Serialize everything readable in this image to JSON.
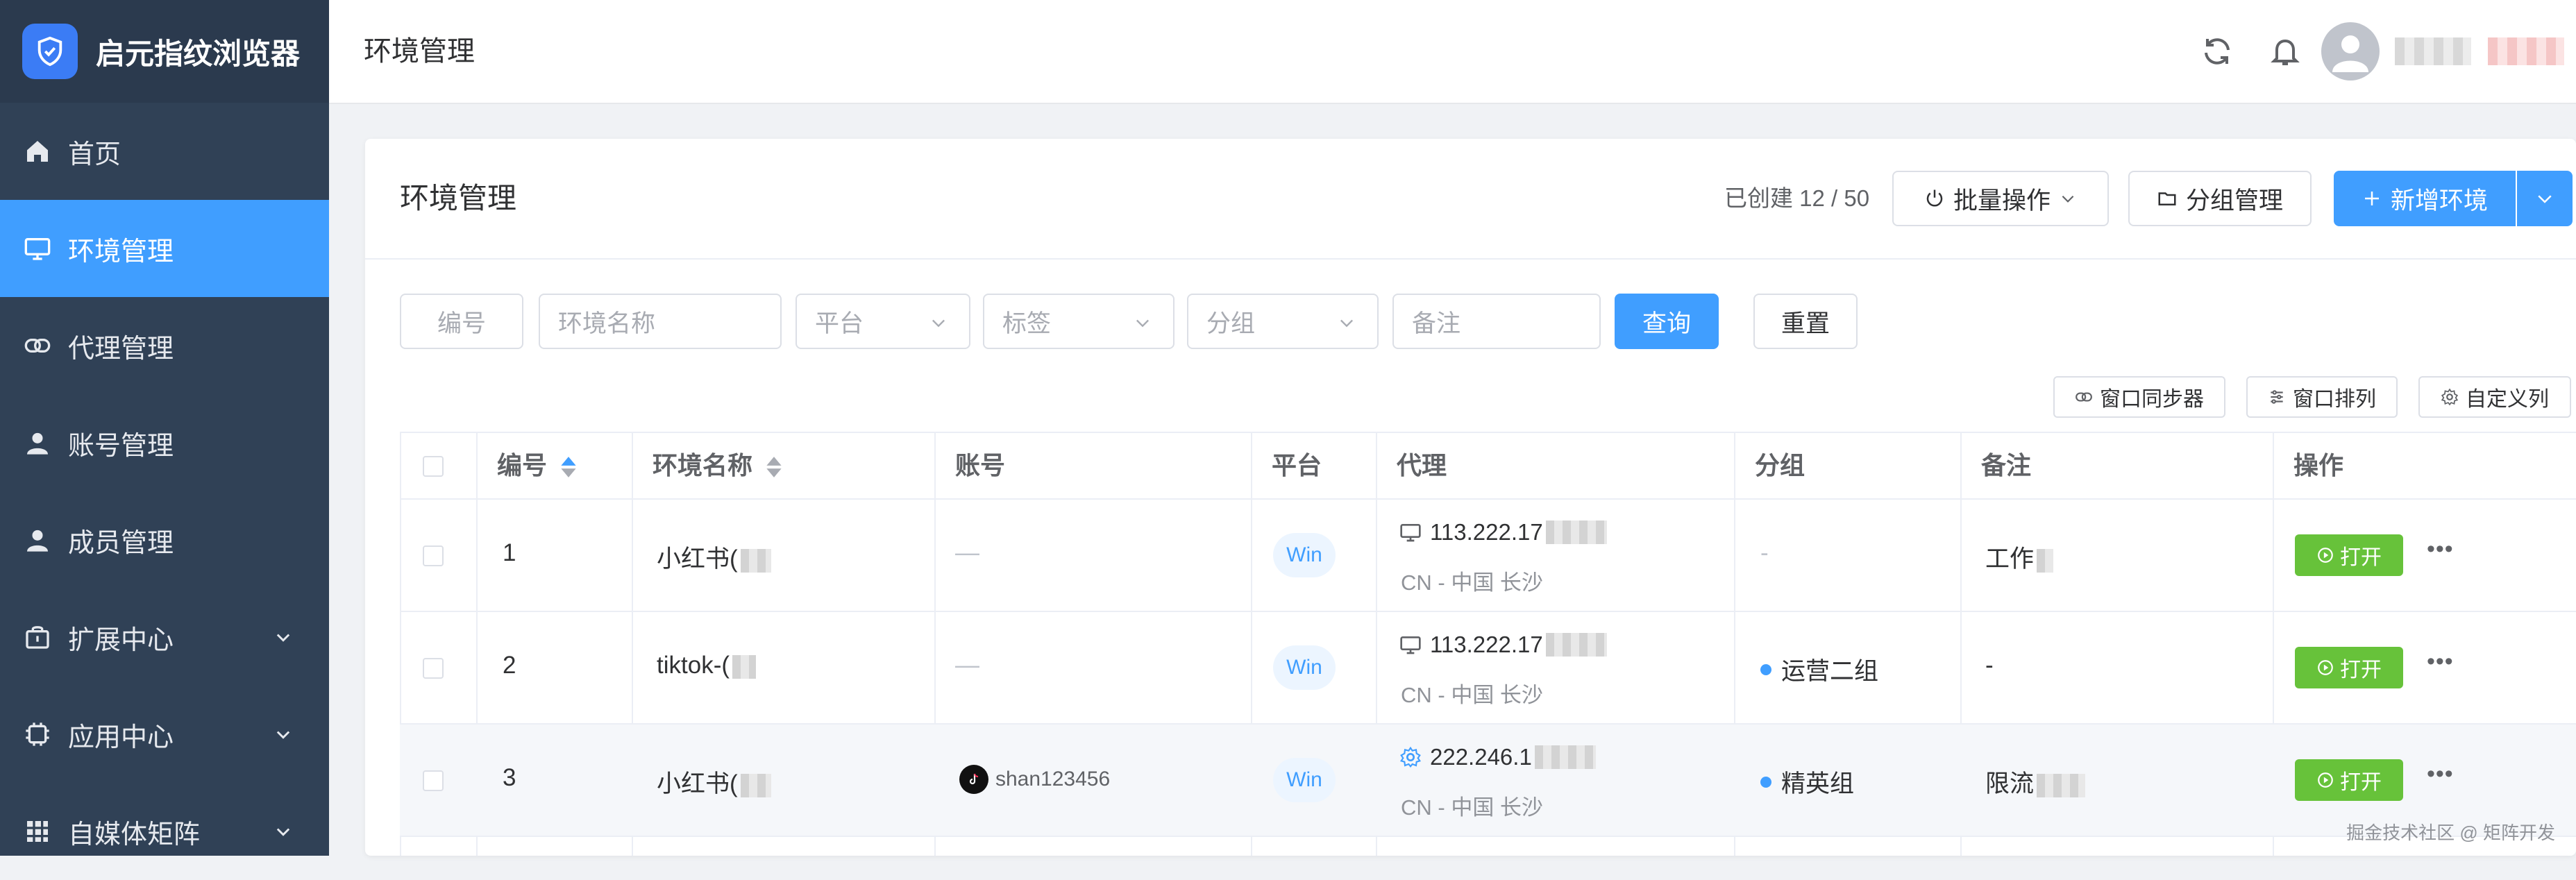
{
  "app": {
    "name": "启元指纹浏览器"
  },
  "sidebar": {
    "items": [
      {
        "label": "首页",
        "icon": "home-icon",
        "active": false
      },
      {
        "label": "环境管理",
        "icon": "monitor-icon",
        "active": true
      },
      {
        "label": "代理管理",
        "icon": "link-icon",
        "active": false
      },
      {
        "label": "账号管理",
        "icon": "user-icon",
        "active": false
      },
      {
        "label": "成员管理",
        "icon": "user-icon",
        "active": false
      },
      {
        "label": "扩展中心",
        "icon": "shop-icon",
        "active": false,
        "expandable": true
      },
      {
        "label": "应用中心",
        "icon": "cpu-icon",
        "active": false,
        "expandable": true
      },
      {
        "label": "自媒体矩阵",
        "icon": "grid-icon",
        "active": false,
        "expandable": true
      }
    ]
  },
  "topbar": {
    "title": "环境管理"
  },
  "card": {
    "title": "环境管理",
    "created_count": "已创建 12 / 50",
    "batch_label": "批量操作",
    "group_manage_label": "分组管理",
    "new_env_label": "新增环境"
  },
  "filters": {
    "id_placeholder": "编号",
    "name_placeholder": "环境名称",
    "platform_placeholder": "平台",
    "tag_placeholder": "标签",
    "group_placeholder": "分组",
    "note_placeholder": "备注",
    "query_label": "查询",
    "reset_label": "重置"
  },
  "tools": {
    "sync_label": "窗口同步器",
    "arrange_label": "窗口排列",
    "custom_label": "自定义列"
  },
  "table": {
    "columns": [
      "编号",
      "环境名称",
      "账号",
      "平台",
      "代理",
      "分组",
      "备注",
      "操作"
    ],
    "rows": [
      {
        "id": "1",
        "name": "小红书(",
        "account": "—",
        "platform": "Win",
        "proxy_ip": "113.222.17",
        "proxy_loc": "CN - 中国 长沙",
        "group": "-",
        "note": "工作",
        "action": "打开"
      },
      {
        "id": "2",
        "name": "tiktok-(",
        "account": "—",
        "platform": "Win",
        "proxy_ip": "113.222.17",
        "proxy_loc": "CN - 中国 长沙",
        "group": "运营二组",
        "note": "-",
        "action": "打开"
      },
      {
        "id": "3",
        "name": "小红书(",
        "account": "shan123456",
        "platform": "Win",
        "proxy_ip": "222.246.1",
        "proxy_loc": "CN - 中国 长沙",
        "group": "精英组",
        "note": "限流",
        "action": "打开"
      }
    ]
  },
  "watermark": "掘金技术社区 @ 矩阵开发",
  "colors": {
    "sidebar_bg": "#304156",
    "active": "#409eff",
    "open_btn": "#67c23a"
  }
}
